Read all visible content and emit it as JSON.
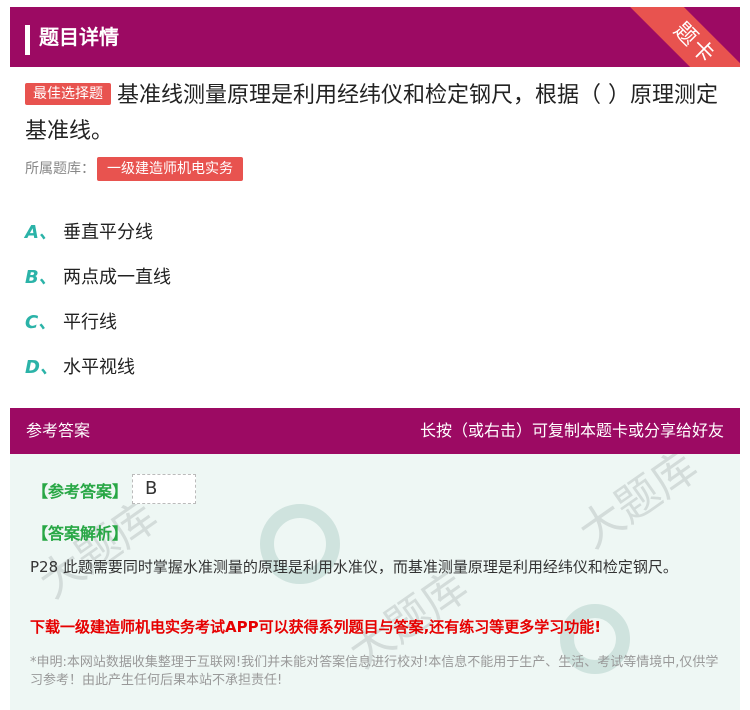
{
  "header": {
    "title": "题目详情",
    "corner_label": "题卡"
  },
  "question": {
    "type_badge": "最佳选择题",
    "text": "基准线测量原理是利用经纬仪和检定钢尺，根据（    ）原理测定基准线。",
    "source_label": "所属题库：",
    "source_tag": "一级建造师机电实务"
  },
  "options": [
    {
      "letter": "A、",
      "text": "垂直平分线"
    },
    {
      "letter": "B、",
      "text": "两点成一直线"
    },
    {
      "letter": "C、",
      "text": "平行线"
    },
    {
      "letter": "D、",
      "text": "水平视线"
    }
  ],
  "answer_section": {
    "title": "参考答案",
    "hint": "长按（或右击）可复制本题卡或分享给好友",
    "answer_label": "【参考答案】",
    "answer_value": "B",
    "analysis_label": "【答案解析】",
    "analysis_text": "P28 此题需要同时掌握水准测量的原理是利用水准仪，而基准测量原理是利用经纬仪和检定钢尺。",
    "promo": "下载一级建造师机电实务考试APP可以获得系列题目与答案,还有练习等更多学习功能!",
    "disclaimer": "*申明:本网站数据收集整理于互联网!我们并未能对答案信息进行校对!本信息不能用于生产、生活、考试等情境中,仅供学习参考！由此产生任何后果本站不承担责任!"
  },
  "colors": {
    "brand": "#9c0a63",
    "accent": "#e8534f",
    "option_letter": "#2bb3a8",
    "answer_green": "#28a745",
    "promo_red": "#e60000"
  }
}
